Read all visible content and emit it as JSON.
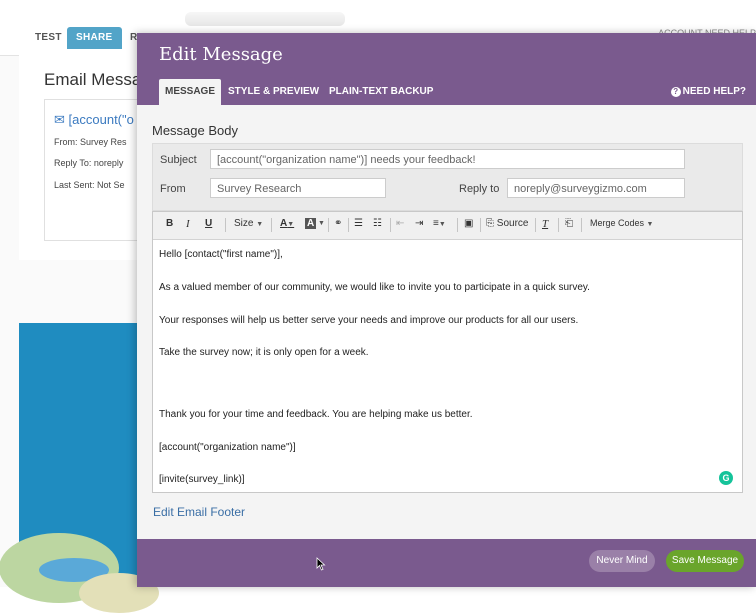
{
  "background": {
    "tabs": [
      "TEST",
      "SHARE",
      "R"
    ],
    "top_right": "ACCOUNT   NEED HELP",
    "heading": "Email Messa",
    "card": {
      "link": "[account(\"o",
      "from": "From: Survey Res",
      "reply_to": "Reply To: noreply",
      "last_sent": "Last Sent: Not Se"
    }
  },
  "modal": {
    "title": "Edit Message",
    "tabs": [
      "MESSAGE",
      "STYLE & PREVIEW",
      "PLAIN-TEXT BACKUP"
    ],
    "help": "NEED HELP?",
    "section_title": "Message Body",
    "subject_label": "Subject",
    "subject_value": "[account(\"organization name\")] needs your feedback!",
    "from_label": "From",
    "from_value": "Survey Research",
    "reply_label": "Reply to",
    "reply_value": "noreply@surveygizmo.com",
    "toolbar": {
      "bold": "B",
      "italic": "I",
      "underline": "U",
      "size": "Size",
      "font_color": "A",
      "source": "Source",
      "merge_codes": "Merge Codes"
    },
    "body_lines": [
      "Hello [contact(\"first name\")],",
      "As a valued member of our community, we would like to invite you to participate in a quick survey.",
      "Your responses will help us better serve your needs and improve our products for all our users.",
      "Take the survey now; it is only open for a week.",
      "Thank you for your time and feedback. You are helping make us better.",
      "[account(\"organization name\")]",
      "[invite(survey_link)]"
    ],
    "grammarly_badge": "G",
    "footer_link": "Edit Email Footer",
    "buttons": {
      "never_mind": "Never Mind",
      "save": "Save Message"
    }
  },
  "colors": {
    "header_purple": "#7a5a8e",
    "save_green": "#6aa52b",
    "link_blue": "#3a6ea5",
    "share_tab_blue": "#52a4c8"
  }
}
